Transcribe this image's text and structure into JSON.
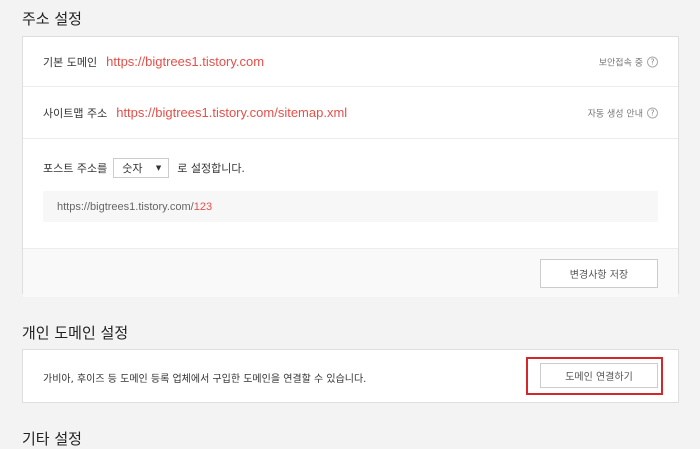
{
  "address_section": {
    "title": "주소 설정",
    "default_domain": {
      "label": "기본 도메인",
      "url": "https://bigtrees1.tistory.com",
      "right_text": "보안접속 중",
      "help": "?"
    },
    "sitemap": {
      "label": "사이트맵 주소",
      "url": "https://bigtrees1.tistory.com/sitemap.xml",
      "right_text": "자동 생성 안내",
      "help": "?"
    },
    "post_address": {
      "prefix": "포스트 주소를",
      "select_value": "숫자",
      "suffix": "로 설정합니다.",
      "preview_base": "https://bigtrees1.tistory.com/",
      "preview_num": "123"
    },
    "save_label": "변경사항 저장"
  },
  "custom_domain_section": {
    "title": "개인 도메인 설정",
    "description": "가비아, 후이즈 등 도메인 등록 업체에서 구입한 도메인을 연결할 수 있습니다.",
    "connect_label": "도메인 연결하기"
  },
  "other_section": {
    "title": "기타 설정"
  },
  "colors": {
    "accent": "#e4504a",
    "highlight": "#d3282b"
  }
}
